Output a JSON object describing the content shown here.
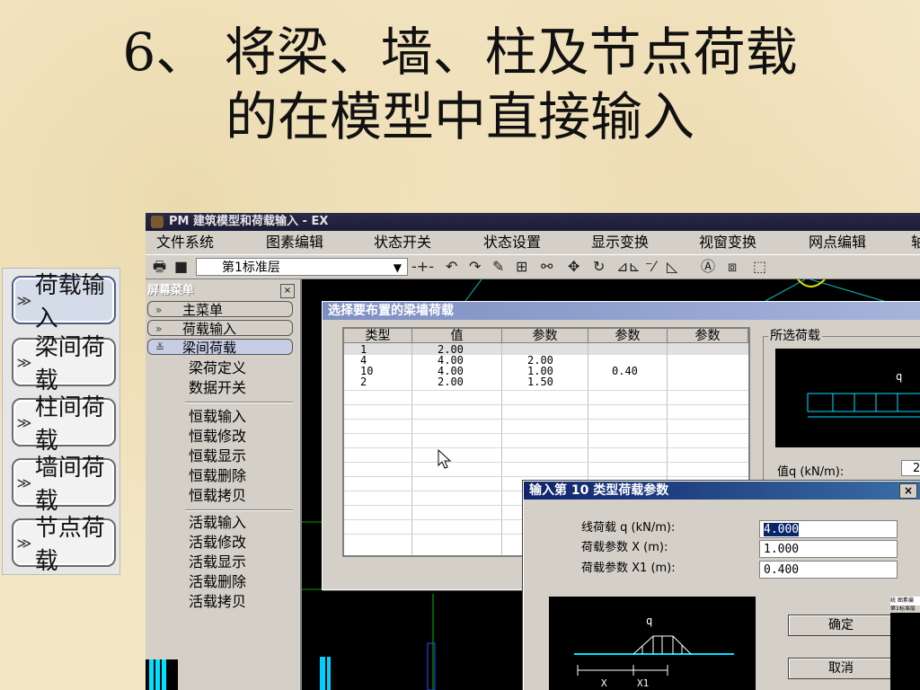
{
  "slide": {
    "title_line1": "6、 将梁、墙、柱及节点荷载",
    "title_line2": "的在模型中直接输入"
  },
  "slide_nav": [
    {
      "label": "荷载输入",
      "chev": "≫"
    },
    {
      "label": "梁间荷载",
      "chev": "≫"
    },
    {
      "label": "柱间荷载",
      "chev": "≫"
    },
    {
      "label": "墙间荷载",
      "chev": "≫"
    },
    {
      "label": "节点荷载",
      "chev": "≫"
    }
  ],
  "app": {
    "title": "PM 建筑模型和荷载输入 - EX",
    "menu": [
      "文件系统",
      "图素编辑",
      "状态开关",
      "状态设置",
      "显示变换",
      "视窗变换",
      "网点编辑",
      "轴"
    ],
    "floor_select": "第1标准层",
    "side_menu": {
      "header": "屏幕菜单",
      "close": "×",
      "tabs": [
        "主菜单",
        "荷载输入",
        "梁间荷载"
      ],
      "group1": [
        "梁荷定义",
        "数据开关"
      ],
      "group2": [
        "恒载输入",
        "恒载修改",
        "恒载显示",
        "恒载删除",
        "恒载拷贝"
      ],
      "group3": [
        "活载输入",
        "活载修改",
        "活载显示",
        "活载删除",
        "活载拷贝"
      ]
    }
  },
  "load_dialog": {
    "title": "选择要布置的梁墙荷载",
    "columns": [
      "类型",
      "值",
      "参数",
      "参数",
      "参数"
    ],
    "rows": [
      [
        "1",
        "2.00",
        "",
        "",
        ""
      ],
      [
        "4",
        "4.00",
        "2.00",
        "",
        ""
      ],
      [
        "10",
        "4.00",
        "1.00",
        "0.40",
        ""
      ],
      [
        "2",
        "2.00",
        "1.50",
        "",
        ""
      ]
    ],
    "preview_legend": "所选荷载",
    "preview_q": "q",
    "value_label": "值q (kN/m):",
    "value_partial": "2"
  },
  "param_dialog": {
    "title": "输入第 10 类型荷载参数",
    "close": "×",
    "fields": [
      {
        "label": "线荷载 q (kN/m):",
        "value": "4.000"
      },
      {
        "label": "荷载参数 X  (m):",
        "value": "1.000"
      },
      {
        "label": "荷载参数 X1 (m):",
        "value": "0.400"
      }
    ],
    "diagram_q": "q",
    "diagram_x": "X",
    "diagram_x1": "X1",
    "ok": "确定",
    "cancel": "取消",
    "mini_menu": "统  图素编",
    "mini_floor": "第1标准层"
  }
}
